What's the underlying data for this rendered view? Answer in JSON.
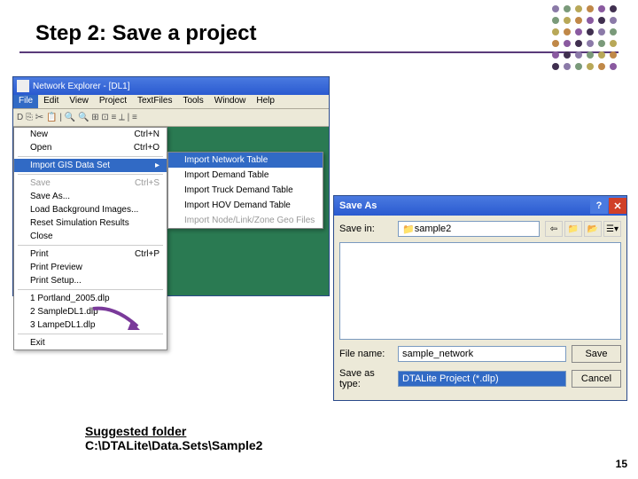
{
  "slide": {
    "title": "Step 2: Save a project",
    "page": "15"
  },
  "app": {
    "title": "Network Explorer - [DL1]",
    "menus": [
      "File",
      "Edit",
      "View",
      "Project",
      "TextFiles",
      "Tools",
      "Window",
      "Help"
    ],
    "toolbar_glyphs": "D  ⎘ ✂ 📋 | 🔍 🔍 ⊞ ⊡ ≡ ⟂ | ≡"
  },
  "fileMenu": {
    "new": "New",
    "new_sc": "Ctrl+N",
    "open": "Open",
    "open_sc": "Ctrl+O",
    "import": "Import GIS Data Set",
    "import_arrow": "▸",
    "save": "Save",
    "save_sc": "Ctrl+S",
    "saveAs": "Save As...",
    "loadBg": "Load Background Images...",
    "reset": "Reset Simulation Results",
    "close": "Close",
    "print": "Print",
    "print_sc": "Ctrl+P",
    "printPrev": "Print Preview",
    "printSetup": "Print Setup...",
    "recent1": "1 Portland_2005.dlp",
    "recent2": "2 SampleDL1.dlp",
    "recent3": "3 LampeDL1.dlp",
    "exit": "Exit"
  },
  "submenu": {
    "i1": "Import Network Table",
    "i2": "Import Demand Table",
    "i3": "Import Truck Demand Table",
    "i4": "Import HOV Demand Table",
    "i5": "Import Node/Link/Zone Geo Files"
  },
  "saveAs": {
    "title": "Save As",
    "saveIn": "Save in:",
    "folder": "sample2",
    "fileNameLbl": "File name:",
    "fileName": "sample_network",
    "typeLbl": "Save as type:",
    "type": "DTALite Project (*.dlp)",
    "saveBtn": "Save",
    "cancelBtn": "Cancel",
    "help": "?",
    "close": "✕"
  },
  "footer": {
    "line1": "Suggested folder",
    "line2": "C:\\DTALite\\Data.Sets\\Sample2"
  }
}
